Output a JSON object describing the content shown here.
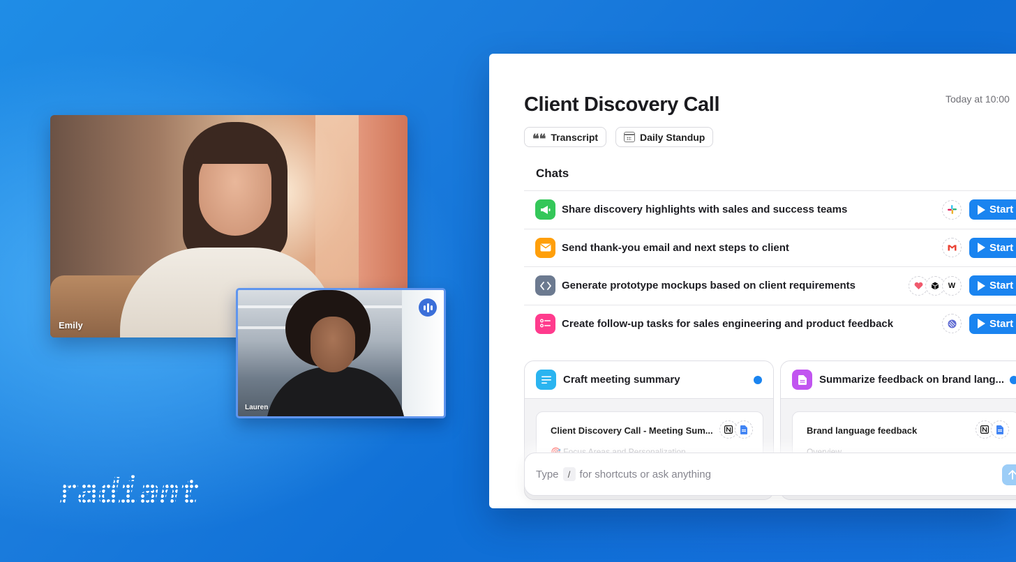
{
  "brand": {
    "logo_text": "radiant"
  },
  "video": {
    "main_participant": "Emily",
    "secondary_participant": "Lauren"
  },
  "meeting": {
    "title": "Client Discovery Call",
    "time": "Today at 10:00",
    "chips": [
      {
        "label": "Transcript",
        "icon": "quote-icon"
      },
      {
        "label": "Daily Standup",
        "icon": "calendar-icon"
      }
    ]
  },
  "chats": {
    "heading": "Chats",
    "start_label": "Start",
    "items": [
      {
        "text": "Share discovery highlights with sales and success teams",
        "icon": "megaphone-icon",
        "color": "#34c759",
        "apps": [
          "slack-icon"
        ]
      },
      {
        "text": "Send thank-you email and next steps to client",
        "icon": "envelope-icon",
        "color": "#ff9f0a",
        "apps": [
          "gmail-icon"
        ]
      },
      {
        "text": "Generate prototype mockups based on client requirements",
        "icon": "code-icon",
        "color": "#6c7a90",
        "apps": [
          "lovable-icon",
          "box-icon",
          "windsurf-icon"
        ]
      },
      {
        "text": "Create follow-up tasks for sales engineering and product feedback",
        "icon": "checklist-icon",
        "color": "#ff3b8d",
        "apps": [
          "linear-icon"
        ]
      }
    ]
  },
  "cards": [
    {
      "title": "Craft meeting summary",
      "icon": "list-icon",
      "color": "#2ab4f0",
      "doc_title": "Client Discovery Call - Meeting Sum...",
      "doc_sub": "🎯 Focus Areas and Personalization",
      "apps": [
        "notion-icon",
        "google-docs-icon"
      ]
    },
    {
      "title": "Summarize feedback on brand lang...",
      "icon": "document-icon",
      "color": "#c154f0",
      "doc_title": "Brand language feedback",
      "doc_sub": "Overview",
      "apps": [
        "notion-icon",
        "google-docs-icon"
      ]
    }
  ],
  "input": {
    "prefix": "Type",
    "key": "/",
    "suffix": "for shortcuts or ask anything"
  },
  "colors": {
    "accent": "#1a84f0"
  }
}
